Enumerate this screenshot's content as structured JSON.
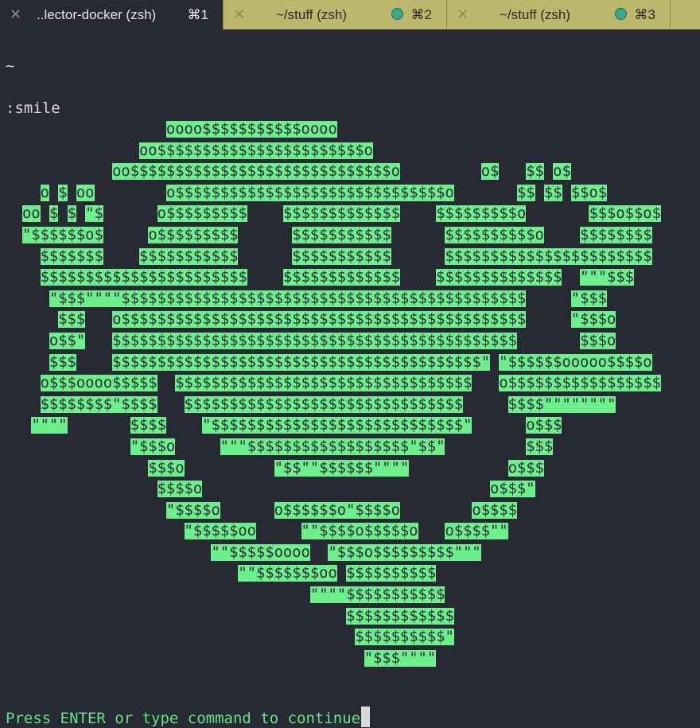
{
  "tabs": [
    {
      "title": "..lector-docker (zsh)",
      "shortcut": "⌘1",
      "active": true
    },
    {
      "title": "~/stuff (zsh)",
      "shortcut": "⌘2",
      "active": false
    },
    {
      "title": "~/stuff (zsh)",
      "shortcut": "⌘3",
      "active": false
    }
  ],
  "terminal": {
    "prompt_line": "~",
    "command_line": ":smile",
    "ascii_art": [
      "                oooo$$$$$$$$$$$oooo",
      "             oo$$$$$$$$$$$$$$$$$$$$$$$o",
      "          oo$$$$$$$$$$$$$$$$$$$$$$$$$$$$$o         o$   $$ o$",
      "  o $ oo        o$$$$$$$$$$$$$$$$$$$$$$$$$$$$$$o       $$ $$ $$o$",
      "oo $ $ \"$      o$$$$$$$$$    $$$$$$$$$$$$$    $$$$$$$$$o       $$$o$$o$",
      "\"$$$$$$o$     o$$$$$$$$$      $$$$$$$$$$$      $$$$$$$$$$o    $$$$$$$$",
      "  $$$$$$$    $$$$$$$$$$$      $$$$$$$$$$$      $$$$$$$$$$$$$$$$$$$$$$$",
      "  $$$$$$$$$$$$$$$$$$$$$$$    $$$$$$$$$$$$$    $$$$$$$$$$$$$$  \"\"\"$$$",
      "   \"$$$\"\"\"\"$$$$$$$$$$$$$$$$$$$$$$$$$$$$$$$$$$$$$$$$$$$$$     \"$$$",
      "    $$$   o$$$$$$$$$$$$$$$$$$$$$$$$$$$$$$$$$$$$$$$$$$$$$     \"$$$o",
      "   o$$\"   $$$$$$$$$$$$$$$$$$$$$$$$$$$$$$$$$$$$$$$$$$$$$       $$$o",
      "   $$$    $$$$$$$$$$$$$$$$$$$$$$$$$$$$$$$$$$$$$$$$$\" \"$$$$$$ooooo$$$$o",
      "  o$$$oooo$$$$$  $$$$$$$$$$$$$$$$$$$$$$$$$$$$$$$$$   o$$$$$$$$$$$$$$$$$",
      "  $$$$$$$$\"$$$$   $$$$$$$$$$$$$$$$$$$$$$$$$$$$$$$     $$$$\"\"\"\"\"\"\"\"",
      " \"\"\"\"       $$$$    \"$$$$$$$$$$$$$$$$$$$$$$$$$$$$\"      o$$$",
      "            \"$$$o     \"\"\"$$$$$$$$$$$$$$$$$$\"$$\"         $$$",
      "              $$$o          \"$$\"\"$$$$$$\"\"\"\"           o$$$",
      "               $$$$o                                o$$$\"",
      "                \"$$$$o      o$$$$$$o\"$$$$o        o$$$$",
      "                  \"$$$$$oo     \"\"$$$$o$$$$$o   o$$$$\"\"",
      "                     \"\"$$$$$oooo  \"$$$o$$$$$$$$$\"\"\"",
      "                        \"\"$$$$$$$oo $$$$$$$$$$",
      "                                \"\"\"\"$$$$$$$$$$$",
      "                                    $$$$$$$$$$$$",
      "                                     $$$$$$$$$$\"",
      "                                      \"$$$\"\"\"\""
    ],
    "status_message": "Press ENTER or type command to continue"
  },
  "colors": {
    "background": "#272a33",
    "art_fill": "#6cf08c",
    "art_text": "#2a2d36",
    "status_text": "#63e58a",
    "tabbar": "#ccc87a"
  }
}
